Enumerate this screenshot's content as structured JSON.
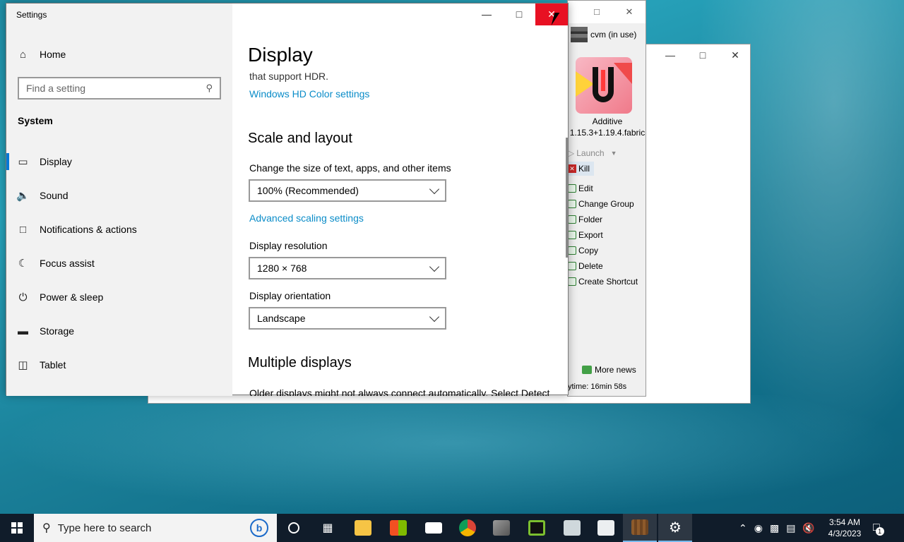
{
  "settings": {
    "title": "Settings",
    "home": "Home",
    "search_placeholder": "Find a setting",
    "section": "System",
    "nav": [
      {
        "label": "Display",
        "icon": "monitor-icon"
      },
      {
        "label": "Sound",
        "icon": "speaker-icon"
      },
      {
        "label": "Notifications & actions",
        "icon": "notification-icon"
      },
      {
        "label": "Focus assist",
        "icon": "moon-icon"
      },
      {
        "label": "Power & sleep",
        "icon": "power-icon"
      },
      {
        "label": "Storage",
        "icon": "storage-icon"
      },
      {
        "label": "Tablet",
        "icon": "tablet-icon"
      }
    ],
    "main": {
      "heading": "Display",
      "hdr_text": "that support HDR.",
      "hdr_link": "Windows HD Color settings",
      "scale_heading": "Scale and layout",
      "scale_label": "Change the size of text, apps, and other items",
      "scale_value": "100% (Recommended)",
      "advanced_link": "Advanced scaling settings",
      "resolution_label": "Display resolution",
      "resolution_value": "1280 × 768",
      "orientation_label": "Display orientation",
      "orientation_value": "Landscape",
      "multi_heading": "Multiple displays",
      "multi_text": "Older displays might not always connect automatically. Select Detect"
    }
  },
  "launcher": {
    "account": "cvm (in use)",
    "instance_name": "Additive",
    "instance_version": "1.15.3+1.19.4.fabric",
    "actions": [
      "Launch",
      "Kill",
      "Edit",
      "Change Group",
      "Folder",
      "Export",
      "Copy",
      "Delete",
      "Create Shortcut"
    ],
    "news": "More news",
    "playtime": "ytime: 16min 58s"
  },
  "taskbar": {
    "search_placeholder": "Type here to search",
    "time": "3:54 AM",
    "date": "4/3/2023",
    "notification_count": "1"
  }
}
